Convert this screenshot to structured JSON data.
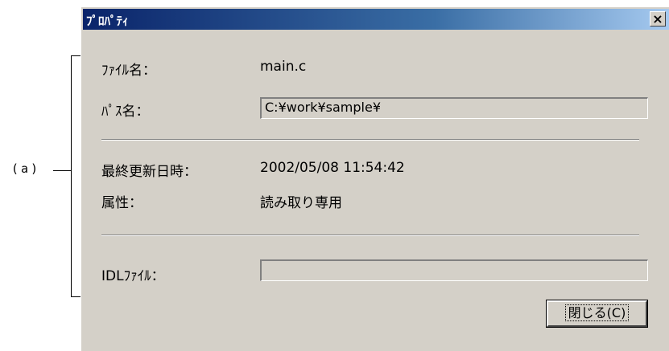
{
  "annotation": {
    "label": "(a)"
  },
  "dialog": {
    "title": "ﾌﾟﾛﾊﾟﾃｨ",
    "close_glyph": "×",
    "fields": {
      "filename_label": "ﾌｧｲﾙ名：",
      "filename_value": "main.c",
      "path_label": "ﾊﾟｽ名：",
      "path_value": "C:¥work¥sample¥",
      "modified_label": "最終更新日時：",
      "modified_value": "2002/05/08  11:54:42",
      "attr_label": "属性：",
      "attr_value": "読み取り専用",
      "idl_label": "IDLﾌｧｲﾙ：",
      "idl_value": ""
    },
    "close_button_label": "閉じる(C)"
  }
}
